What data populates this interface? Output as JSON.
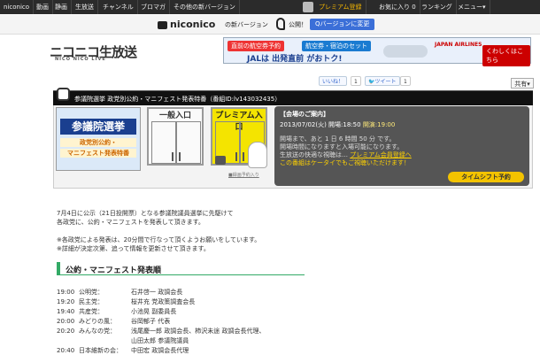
{
  "topnav": {
    "items": [
      "niconico",
      "動画",
      "静画",
      "生放送",
      "チャンネル",
      "ブロマガ",
      "その他の新バージョン"
    ],
    "premium": "プレミアム登録",
    "favorites": "お気に入り 0",
    "ranking": "ランキング",
    "menu": "メニュー▾"
  },
  "announce": {
    "logo": "niconico",
    "new_version": "の新バージョン",
    "released": "公開！",
    "q_button": "Qバージョンに変更"
  },
  "site_logo": {
    "main": "ニコニコ生放送",
    "sub": "NICO NICO LIVE"
  },
  "ad": {
    "tag1": "直前の航空券予約",
    "tag2": "航空券・宿泊のセット",
    "headline": "JALは 出発直前 がおトク!",
    "brand": "JAPAN AIRLINES",
    "button": "くわしくはこちら"
  },
  "share": {
    "like": "いいね！",
    "like_count": "1",
    "tweet": "ツイート",
    "tweet_count": "1",
    "share": "共有▾"
  },
  "title": "参議院選挙 政党別公約・マニフェスト発表特番（番組ID:lv143032435）",
  "banner": {
    "line1": "参議院選挙",
    "line2": "政党別公約・",
    "line3": "マニフェスト発表特番"
  },
  "doors": {
    "general": "一般入口",
    "premium": "プレミアム入口",
    "reserve": "■録画予約入り"
  },
  "info": {
    "heading": "【会場のご案内】",
    "date": "2013/07/02(火)",
    "open_label": "開場:18:50",
    "start_label": "開演:19:00",
    "line1": "開場まで、あと 1 日 6 時間 50 分 です。",
    "line2": "開場時間になりますと入場可能になります。",
    "line3_prefix": "生放送の快適な視聴は…",
    "line3_link": "プレミアム会員登録へ",
    "line4": "この番組はケータイでもご視聴いただけます！",
    "timeshift_button": "タイムシフト予約"
  },
  "body": {
    "p1": "7月4日に公示（21日投開票）となる参議院議員選挙に先駆けて",
    "p2": "各政党に、公約・マニフェストを発表して頂きます。",
    "n1": "※各政党による発表は、20分間で行なって頂くようお願いをしています。",
    "n2": "※詳細が決定次第、追って情報を更新させて頂きます。"
  },
  "schedule_heading": "公約・マニフェスト発表順",
  "schedule": [
    {
      "time": "19:00",
      "party": "公明党：",
      "names": "石井啓一 政調会長"
    },
    {
      "time": "19:20",
      "party": "民主党：",
      "names": "桜井充 党政策調査会長"
    },
    {
      "time": "19:40",
      "party": "共産党：",
      "names": "小池晃 副委員長"
    },
    {
      "time": "20:00",
      "party": "みどりの風：",
      "names": "谷岡郁子 代表"
    },
    {
      "time": "20:20",
      "party": "みんなの党：",
      "names": "浅尾慶一郎 政調会長、柿沢未途 政調会長代理、"
    },
    {
      "time": "",
      "party": "",
      "names": "山田太郎 参議院議員"
    },
    {
      "time": "20:40",
      "party": "日本維新の会：",
      "names": "中田宏 政調会長代理"
    }
  ],
  "colors": {
    "topbar": "#2b2b2b",
    "premium": "#f3b500",
    "accent_green": "#33aa66",
    "door_yellow": "#f4e400",
    "info_bg": "#555555"
  }
}
